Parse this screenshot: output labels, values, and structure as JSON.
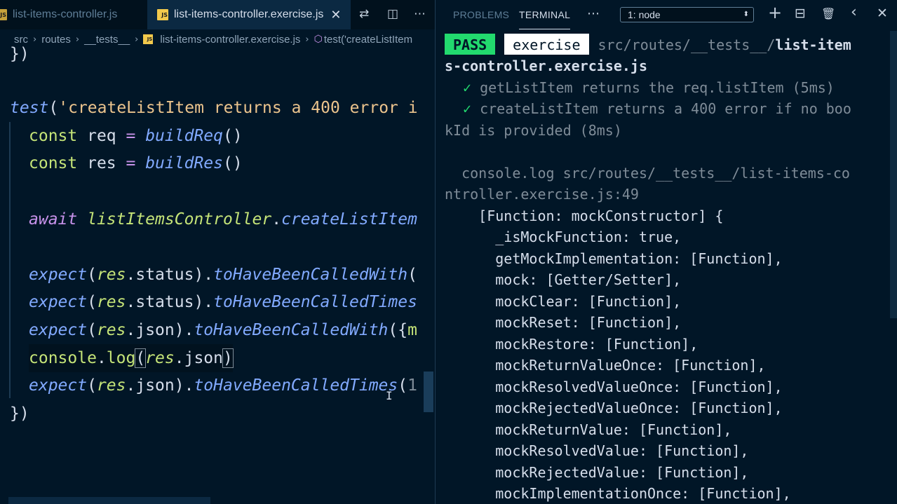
{
  "editor": {
    "tabs": [
      {
        "badge": "JS",
        "label": "list-items-controller.js"
      },
      {
        "badge": "JS",
        "label": "list-items-controller.exercise.js"
      }
    ],
    "close_glyph": "✕",
    "toolbar_icons": {
      "compare": "⇄",
      "split": "◫",
      "more": "⋯"
    },
    "breadcrumb": [
      "src",
      "routes",
      "__tests__",
      "list-items-controller.exercise.js",
      "test('createListItem"
    ],
    "breadcrumb_sep": "›",
    "code_lines": {
      "l1": "})",
      "l3_kw": "test",
      "l3_open": "(",
      "l3_str": "'createListItem returns a 400 error i",
      "l4_const": "const",
      "l4_var": " req ",
      "l4_eq": "=",
      "l4_fn": " buildReq",
      "l4_paren": "()",
      "l5_const": "const",
      "l5_var": " res ",
      "l5_eq": "=",
      "l5_fn": " buildRes",
      "l5_paren": "()",
      "l7_await": "await",
      "l7_obj": " listItemsController",
      "l7_dot": ".",
      "l7_method": "createListItem",
      "l9_expect": "expect",
      "l9_open": "(",
      "l9_obj": "res",
      "l9_dot": ".",
      "l9_prop": "status",
      "l9_close": ").",
      "l9_method": "toHaveBeenCalledWith",
      "l9_end": "(",
      "l10_expect": "expect",
      "l10_open": "(",
      "l10_obj": "res",
      "l10_dot": ".",
      "l10_prop": "status",
      "l10_close": ").",
      "l10_method": "toHaveBeenCalledTimes",
      "l11_expect": "expect",
      "l11_open": "(",
      "l11_obj": "res",
      "l11_dot": ".",
      "l11_prop": "json",
      "l11_close": ").",
      "l11_method": "toHaveBeenCalledWith",
      "l11_end": "({",
      "l11_tail": "m",
      "l12_console": "console",
      "l12_dot": ".",
      "l12_log": "log",
      "l12_open": "(",
      "l12_obj": "res",
      "l12_dot2": ".",
      "l12_prop": "json",
      "l12_close": ")",
      "l13_expect": "expect",
      "l13_open": "(",
      "l13_obj": "res",
      "l13_dot": ".",
      "l13_prop": "json",
      "l13_close": ").",
      "l13_method": "toHaveBeenCalledTimes",
      "l13_end": "(",
      "l13_tail": "1",
      "l14": "})"
    }
  },
  "panel": {
    "tabs": [
      "PROBLEMS",
      "TERMINAL"
    ],
    "more": "⋯",
    "terminal_select": "1: node",
    "select_arrow": "⬍",
    "icons": {
      "add": "+",
      "split": "⊟",
      "trash": "🗑",
      "prev": "‹",
      "close": "✕"
    }
  },
  "terminal": {
    "pass": "PASS",
    "file_badge": "exercise",
    "path_dim": "src/routes/__tests__/",
    "path_bold_1": "list-item",
    "path_bold_2": "s-controller.exercise.js",
    "check": "✓",
    "test1": " getListItem returns the req.listItem (5ms)",
    "test2a": " createListItem returns a 400 error if no boo",
    "test2b": "kId is provided (8ms)",
    "log1": "  console.log src/routes/__tests__/list-items-co",
    "log2": "ntroller.exercise.js:49",
    "output": [
      "    [Function: mockConstructor] {",
      "      _isMockFunction: true,",
      "      getMockImplementation: [Function],",
      "      mock: [Getter/Setter],",
      "      mockClear: [Function],",
      "      mockReset: [Function],",
      "      mockRestore: [Function],",
      "      mockReturnValueOnce: [Function],",
      "      mockResolvedValueOnce: [Function],",
      "      mockRejectedValueOnce: [Function],",
      "      mockReturnValue: [Function],",
      "      mockResolvedValue: [Function],",
      "      mockRejectedValue: [Function],",
      "      mockImplementationOnce: [Function],"
    ]
  }
}
